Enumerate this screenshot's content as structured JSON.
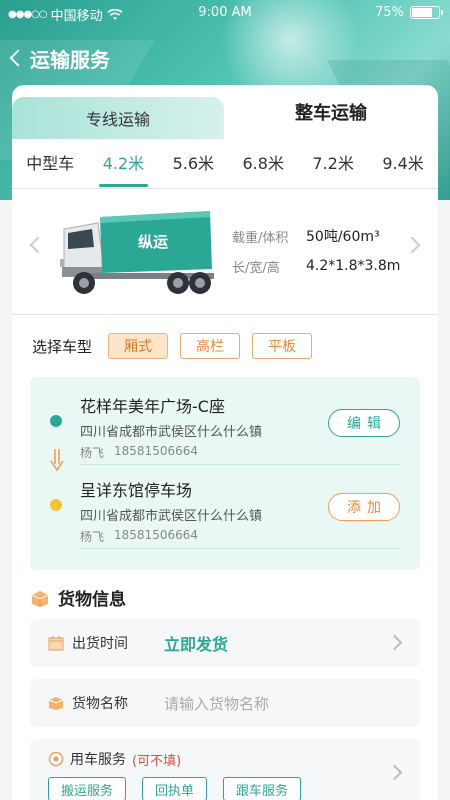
{
  "status_bar": {
    "carrier": "中国移动",
    "time": "9:00 AM",
    "battery": "75%",
    "battery_level": 0.75
  },
  "header": {
    "title": "运输服务"
  },
  "tabs": [
    {
      "label": "专线运输",
      "active": false
    },
    {
      "label": "整车运输",
      "active": true
    }
  ],
  "truck_sizes": [
    {
      "label": "中型车",
      "active": false
    },
    {
      "label": "4.2米",
      "active": true
    },
    {
      "label": "5.6米",
      "active": false
    },
    {
      "label": "6.8米",
      "active": false
    },
    {
      "label": "7.2米",
      "active": false
    },
    {
      "label": "9.4米",
      "active": false
    }
  ],
  "truck": {
    "brand_text": "纵运",
    "specs": [
      {
        "label": "载重/体积",
        "value": "50吨/60m³"
      },
      {
        "label": "长/宽/高",
        "value": "4.2*1.8*3.8m"
      }
    ]
  },
  "vehicle_type": {
    "label": "选择车型",
    "options": [
      {
        "label": "厢式",
        "active": true
      },
      {
        "label": "高栏",
        "active": false
      },
      {
        "label": "平板",
        "active": false
      }
    ]
  },
  "route": {
    "stops": [
      {
        "name": "花样年美年广场-C座",
        "address": "四川省成都市武侯区什么什么镇",
        "contact_name": "杨飞",
        "contact_phone": "18581506664",
        "action": "编辑"
      },
      {
        "name": "呈详东馆停车场",
        "address": "四川省成都市武侯区什么什么镇",
        "contact_name": "杨飞",
        "contact_phone": "18581506664",
        "action": "添加"
      }
    ]
  },
  "cargo": {
    "title": "货物信息",
    "ship_time": {
      "label": "出货时间",
      "value": "立即发货"
    },
    "cargo_name": {
      "label": "货物名称",
      "placeholder": "请输入货物名称"
    },
    "services": {
      "label": "用车服务",
      "optional": "(可不填)",
      "options": [
        "搬运服务",
        "回执单",
        "跟车服务"
      ]
    }
  },
  "colors": {
    "accent": "#2aa895",
    "orange": "#e98a3c",
    "yellow": "#f6c430"
  }
}
